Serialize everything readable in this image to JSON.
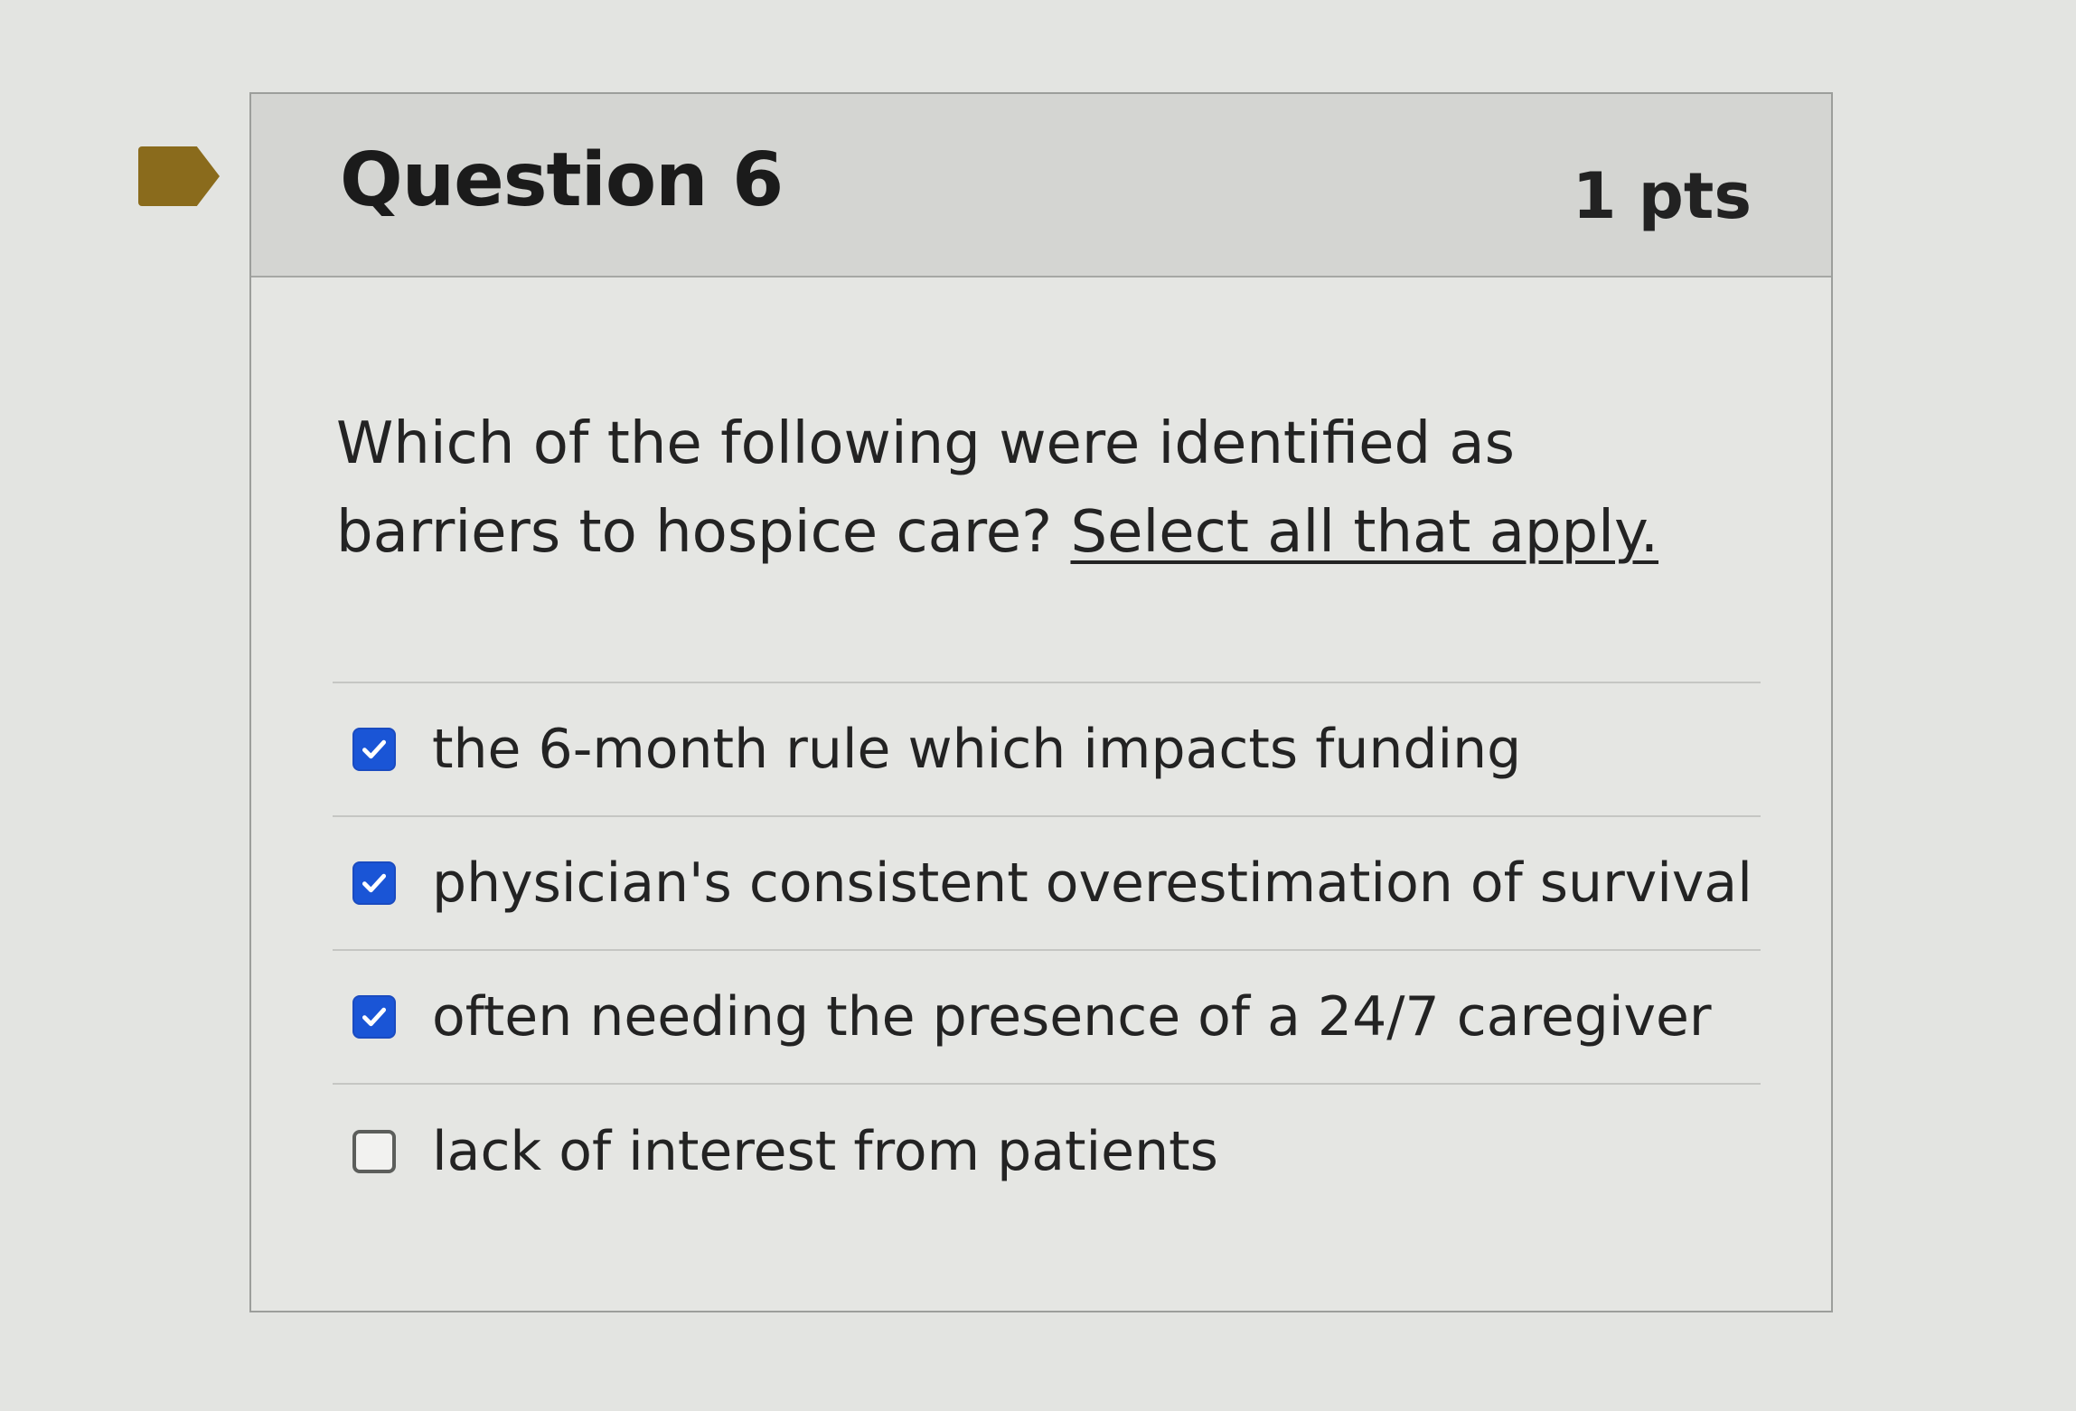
{
  "question": {
    "title": "Question 6",
    "points": "1 pts",
    "prompt": "Which of the following were identified as barriers to hospice care?",
    "instruction": "Select all that apply."
  },
  "answers": [
    {
      "label": "the 6-month rule which impacts funding",
      "checked": true
    },
    {
      "label": "physician's consistent overestimation of survival",
      "checked": true
    },
    {
      "label": "often needing the presence of a 24/7 caregiver",
      "checked": true
    },
    {
      "label": "lack of interest from patients",
      "checked": false
    }
  ],
  "colors": {
    "flag": "#8a6b1c",
    "checkbox_checked": "#1a55d6"
  },
  "icons": {
    "flag": "bookmark-flag-icon",
    "check": "checkmark-icon"
  }
}
